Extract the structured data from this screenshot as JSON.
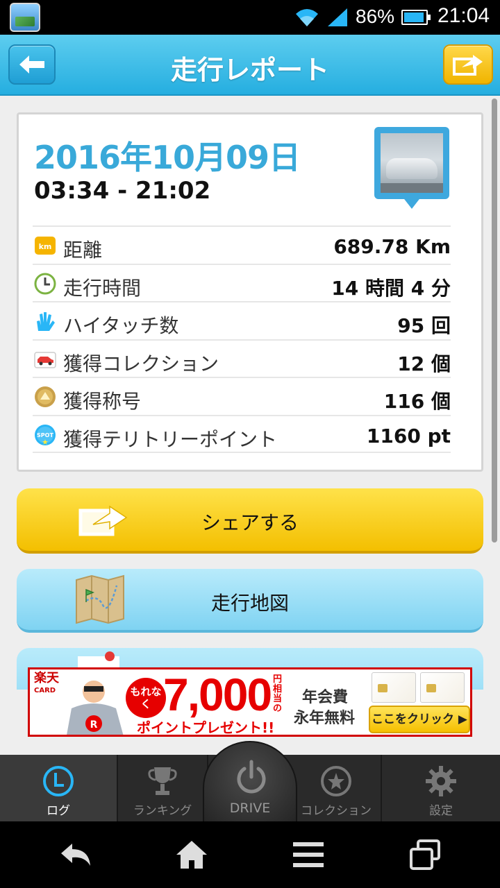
{
  "status_bar": {
    "battery": "86%",
    "time": "21:04"
  },
  "header": {
    "title": "走行レポート"
  },
  "report": {
    "date": "2016年10月09日",
    "time_range": "03:34 - 21:02",
    "stats": [
      {
        "icon": "km-icon",
        "label": "距離",
        "value": "689.78 Km"
      },
      {
        "icon": "clock-icon",
        "label": "走行時間",
        "value": "14 時間 4 分"
      },
      {
        "icon": "hi-five-icon",
        "label": "ハイタッチ数",
        "value": "95 回"
      },
      {
        "icon": "car-icon",
        "label": "獲得コレクション",
        "value": "12 個"
      },
      {
        "icon": "medal-icon",
        "label": "獲得称号",
        "value": "116 個"
      },
      {
        "icon": "spot-icon",
        "label": "獲得テリトリーポイント",
        "value": "1160 pt"
      }
    ],
    "icon_km_text": "km",
    "icon_spot_text": "SPOT"
  },
  "actions": {
    "share_label": "シェアする",
    "map_label": "走行地図"
  },
  "ad": {
    "logo": "楽天",
    "logo_sub": "CARD",
    "badge": "もれなく",
    "amount": "7,000",
    "unit": "円相当の",
    "sub": "ポイントプレゼント!!",
    "fee_line1": "年会費",
    "fee_line2": "永年無料",
    "cta": "ここをクリック ▶"
  },
  "tabs": {
    "log": "ログ",
    "ranking": "ランキング",
    "drive": "DRIVE",
    "collection": "コレクション",
    "settings": "設定"
  },
  "colors": {
    "accent": "#39a9d9",
    "share": "#f3bf00",
    "map": "#7fd3f2"
  }
}
